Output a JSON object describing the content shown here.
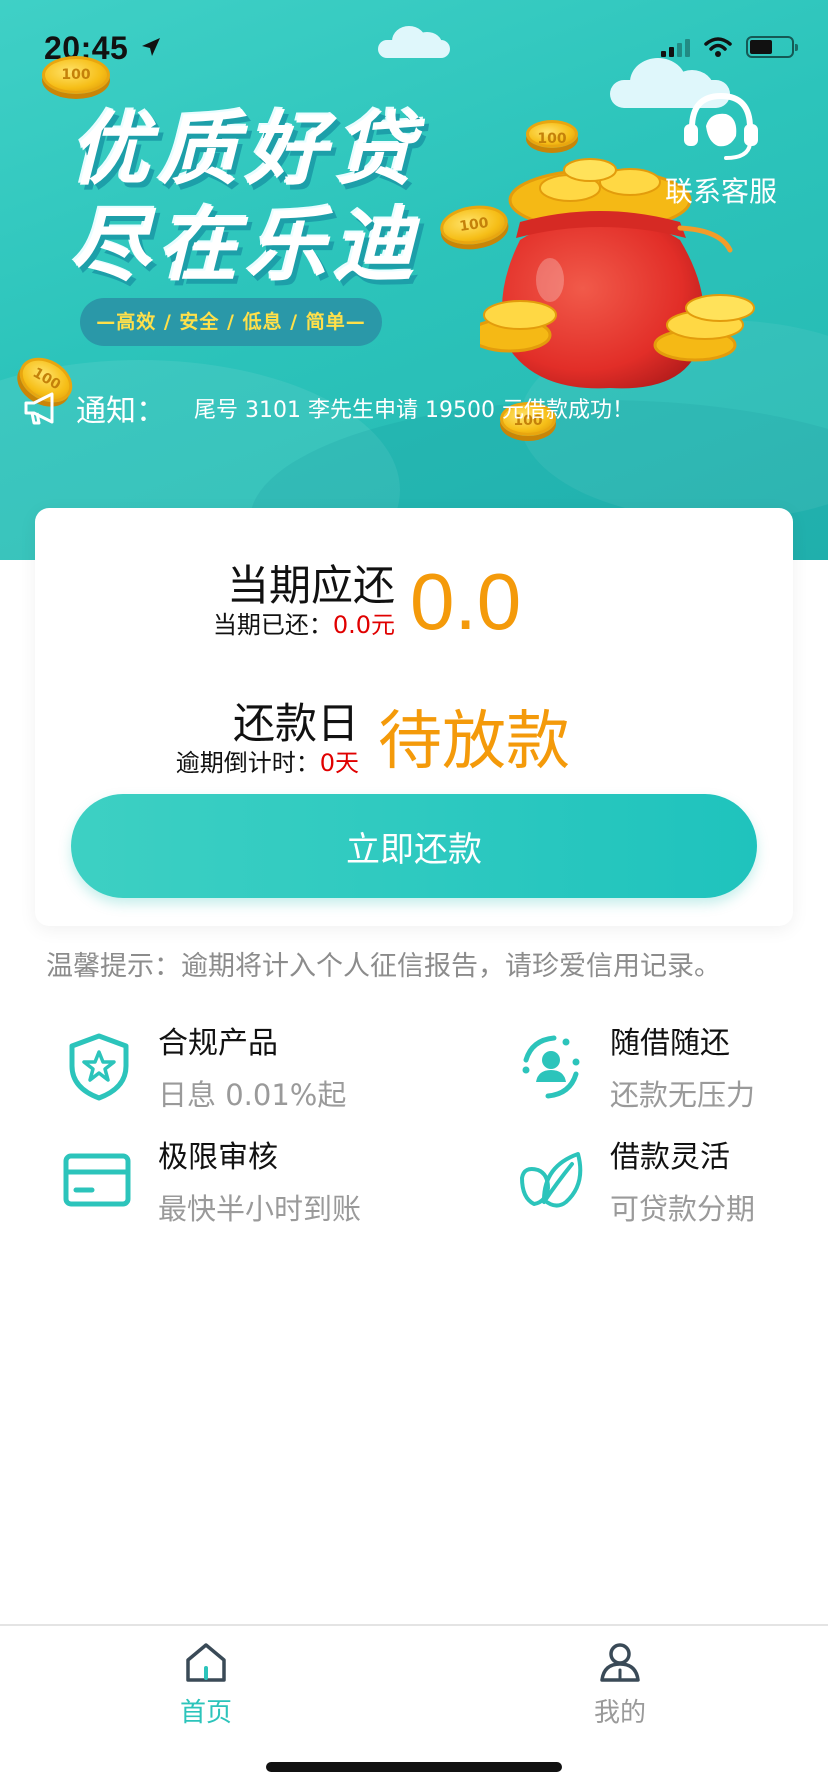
{
  "status_bar": {
    "time": "20:45"
  },
  "banner": {
    "headline_line1": "优质好贷",
    "headline_line2": "尽在乐迪",
    "tagline": "—高效 / 安全 / 低息 / 简单—",
    "customer_service_label": "联系客服",
    "notice_label": "通知：",
    "notice_text": "尾号 3101 李先生申请 19500 元借款成功！"
  },
  "repayment": {
    "current_due_label": "当期应还",
    "current_paid_label": "当期已还：",
    "current_paid_value": "0.0元",
    "current_due_amount": "0.0",
    "repay_day_label": "还款日",
    "overdue_countdown_label": "逾期倒计时：",
    "overdue_countdown_value": "0天",
    "repay_day_status": "待放款",
    "repay_button": "立即还款"
  },
  "tip": "温馨提示：逾期将计入个人征信报告，请珍爱信用记录。",
  "features": [
    {
      "title": "合规产品",
      "subtitle": "日息 0.01%起",
      "icon": "shield-star-icon"
    },
    {
      "title": "随借随还",
      "subtitle": "还款无压力",
      "icon": "user-cycle-icon"
    },
    {
      "title": "极限审核",
      "subtitle": "最快半小时到账",
      "icon": "card-icon"
    },
    {
      "title": "借款灵活",
      "subtitle": "可贷款分期",
      "icon": "leaf-icon"
    }
  ],
  "tabs": [
    {
      "label": "首页",
      "icon": "home-icon",
      "active": true
    },
    {
      "label": "我的",
      "icon": "profile-icon",
      "active": false
    }
  ],
  "colors": {
    "accent": "#2cc4bb",
    "amount": "#f49a0a",
    "alert": "#e00000",
    "muted": "#9a9a9a"
  }
}
